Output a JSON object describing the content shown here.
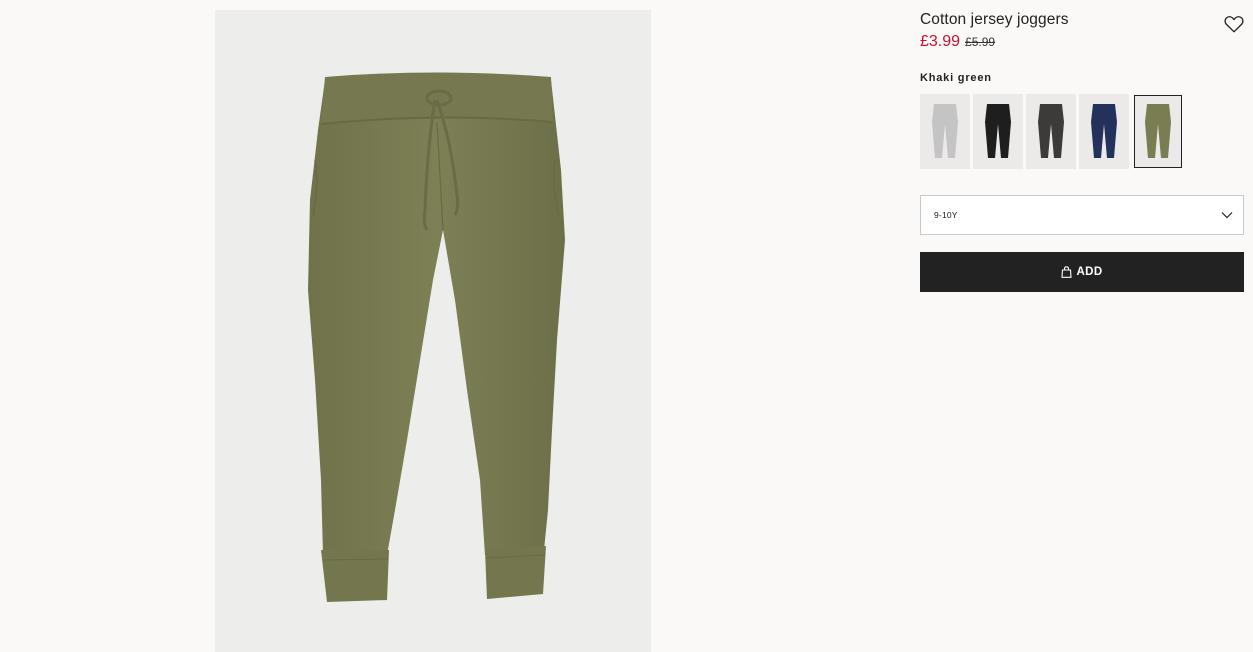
{
  "product": {
    "name": "Cotton jersey joggers",
    "sale_price": "£3.99",
    "original_price": "£5.99",
    "color_name": "Khaki green"
  },
  "colors": {
    "accent_sale": "#c8102e",
    "button_bg": "#222222",
    "selected_pant": "#7a7c52"
  },
  "swatches": [
    {
      "name": "light grey",
      "color": "#c4c4c4",
      "selected": false
    },
    {
      "name": "black",
      "color": "#1e1e1e",
      "selected": false
    },
    {
      "name": "dark grey",
      "color": "#3c3b3a",
      "selected": false
    },
    {
      "name": "navy blue",
      "color": "#23325c",
      "selected": false
    },
    {
      "name": "khaki green",
      "color": "#7a7c52",
      "selected": true
    }
  ],
  "size_select": {
    "value": "9-10Y"
  },
  "add_button": {
    "label": "ADD"
  },
  "icons": {
    "favorite": "heart-icon",
    "dropdown": "chevron-down-icon",
    "bag": "shopping-bag-icon"
  }
}
